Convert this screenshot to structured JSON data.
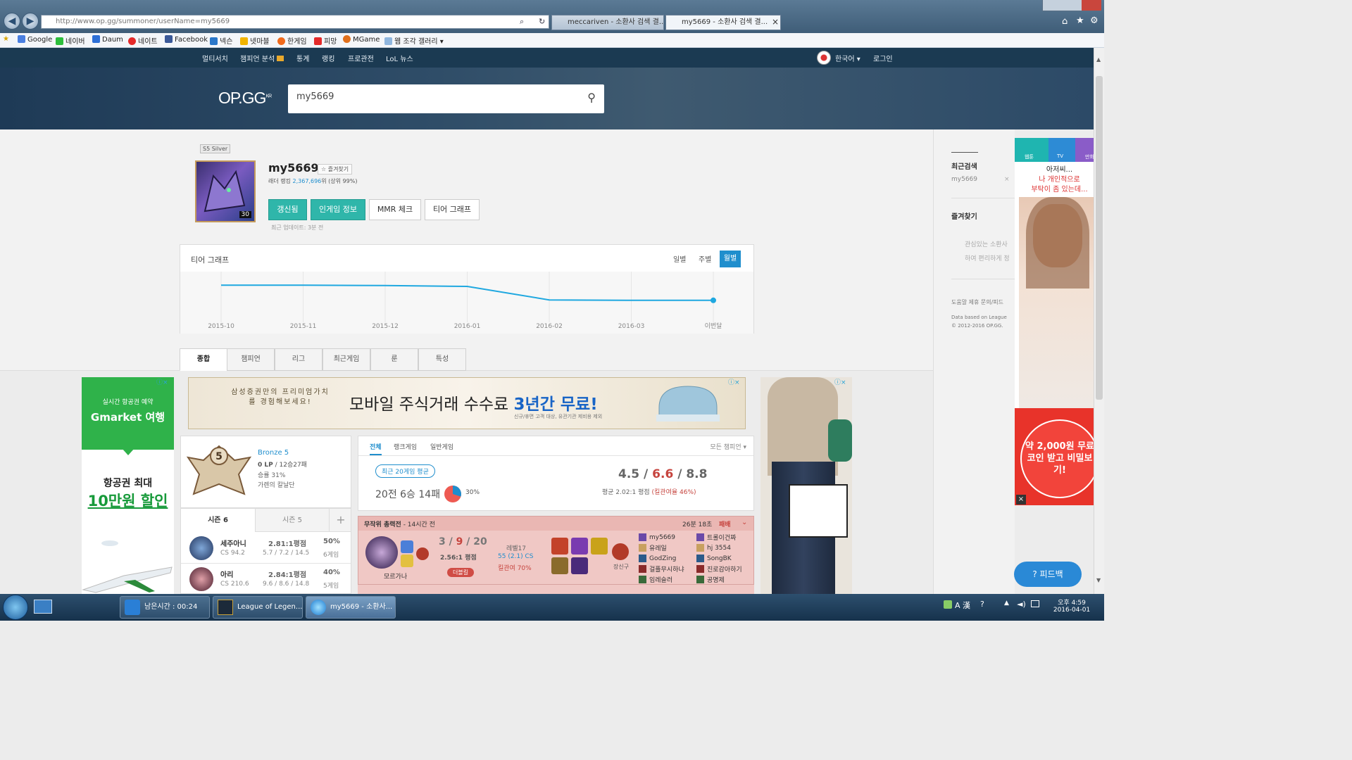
{
  "browser": {
    "address": "http://www.op.gg/summoner/userName=my5669",
    "tabs": [
      {
        "label": "meccariven - 소환사 검색 결..."
      },
      {
        "label": "my5669 - 소환사 검색 결..."
      }
    ],
    "tab_close": "×"
  },
  "favorites": [
    "Google",
    "네이버",
    "Daum",
    "네이트",
    "Facebook",
    "넥슨",
    "넷마블",
    "한게임",
    "피망",
    "MGame",
    "웹 조각 갤러리 ▾"
  ],
  "site": {
    "nav": [
      "멀티서치",
      "챔피언 분석",
      "통계",
      "랭킹",
      "프로관전",
      "LoL 뉴스"
    ],
    "lang": "한국어 ▾",
    "login": "로그인",
    "logo": "OP.GG",
    "logo_region": "KR",
    "search_value": "my5669"
  },
  "profile": {
    "tier_badge": "S5 Silver",
    "name": "my5669",
    "fav": "☆ 즐겨찾기",
    "ladder_prefix": "래더 랭킹 ",
    "ladder_rank": "2,367,696",
    "ladder_suffix": "위 (상위 99%)",
    "level": "30",
    "buttons": [
      "갱신됨",
      "인게임 정보",
      "MMR 체크",
      "티어 그래프"
    ],
    "updated": "최근 업데이트: 3분 전"
  },
  "tier_graph": {
    "title": "티어 그래프",
    "periods": [
      "일별",
      "주별",
      "월별"
    ],
    "active": "월별"
  },
  "chart_data": {
    "type": "line",
    "x": [
      "2015-10",
      "2015-11",
      "2015-12",
      "2016-01",
      "2016-02",
      "2016-03",
      "이번달"
    ],
    "values": [
      0.78,
      0.78,
      0.77,
      0.75,
      0.43,
      0.42,
      0.42
    ],
    "title": "티어 그래프",
    "grid": true
  },
  "tabs": [
    "종합",
    "챔피언",
    "리그",
    "최근게임",
    "룬",
    "특성"
  ],
  "ads": {
    "left_top": "실시간 항공권 예약",
    "left_brand": "Gmarket 여행",
    "left_main1": "항공권 최대",
    "left_main2": "10만원 할인",
    "banner_left": "삼성증권만의 프리미엄가치를 경험해보세요!",
    "banner_main": "모바일 주식거래 수수료 ",
    "banner_highlight": "3년간 무료!",
    "banner_sub": "신규/휴면 고객 대상, 유관기관 제비용 제외",
    "right_tabs": [
      "웹툰",
      "TV",
      "만화"
    ],
    "right_text1": "아저씨...",
    "right_text2": "나 개인적으로",
    "right_text3": "부탁이 좀 있는데...",
    "right_promo": "약 2,000원 무료코인 받고 비밀보기!"
  },
  "rank": {
    "tier": "Bronze 5",
    "lp": "0 LP",
    "record": "/ 12승27패",
    "winrate": "승률 31%",
    "league": "가렌의 칼날단",
    "season_tabs": [
      "시즌 6",
      "시즌 5",
      "+"
    ]
  },
  "champ_stats": [
    {
      "name": "세주아니",
      "cs": "CS 94.2",
      "kda": "2.81:1평점",
      "detail": "5.7 / 7.2 / 14.5",
      "wr": "50%",
      "games": "6게임"
    },
    {
      "name": "아리",
      "cs": "CS 210.6",
      "kda": "2.84:1평점",
      "detail": "9.6 / 8.6 / 14.8",
      "wr": "40%",
      "games": "5게임"
    }
  ],
  "games_summary": {
    "filters": [
      "전체",
      "랭크게임",
      "일반게임"
    ],
    "champ_filter": "모든 챔피언 ▾",
    "badge": "최근 20게임 평균",
    "record": "20전 6승 14패",
    "pie_pct": "30%",
    "kda_k": "4.5",
    "kda_d": "6.6",
    "kda_a": "8.8",
    "ratio_label": "평균 2.02:1 평점 ",
    "kill_part": "(킬관여율 46%)",
    "win_fraction": 0.3
  },
  "game": {
    "mode": "무작위 총력전",
    "ago": "- 14시간 전",
    "when": "26분 18초",
    "result": "패배",
    "champ": "모르가나",
    "k": "3",
    "d": "9",
    "a": "20",
    "kda": "2.56:1 평점",
    "multi": "더블킬",
    "level": "레벨17",
    "cs": "55 (2.1) CS",
    "killp": "킬관여 70%",
    "ward": "장신구",
    "team1": [
      "my5669",
      "유레일",
      "GodZing",
      "걸플무시하냐",
      "임레슬러"
    ],
    "team2": [
      "트롤이건짜",
      "hj 3554",
      "SongBK",
      "진로감아하기",
      "공명제"
    ]
  },
  "sidebar": {
    "recent": "최근검색",
    "recent_item": "my5669",
    "recent_close": "×",
    "fav": "즐겨찾기",
    "fav_desc1": "관심있는 소환사",
    "fav_desc2": "하여 편리하게 정",
    "help": "도움말 제휴 문의/피드",
    "data1": "Data based on League",
    "data2": "© 2012-2016 OP.GG."
  },
  "feedback": "? 피드백",
  "taskbar": {
    "items": [
      "남은시간 : 00:24",
      "League of Legen...",
      "my5669 - 소환사..."
    ],
    "time": "오후 4:59",
    "date": "2016-04-01",
    "ime": "A 漢"
  }
}
